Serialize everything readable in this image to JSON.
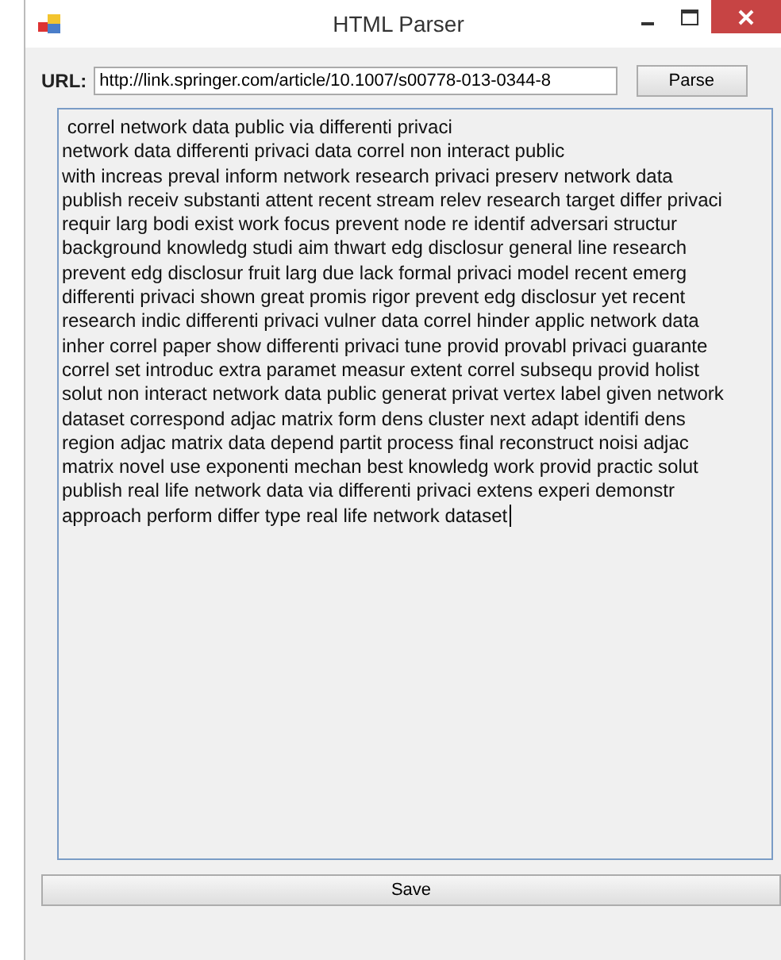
{
  "window": {
    "title": "HTML Parser"
  },
  "url_field": {
    "label": "URL:",
    "value": "http://link.springer.com/article/10.1007/s00778-013-0344-8"
  },
  "parse_button": "Parse",
  "output_lines": [
    " correl network data public via differenti privaci",
    "network data differenti privaci data correl non interact public",
    "with increas preval inform network research privaci preserv network data",
    "publish receiv substanti attent recent stream relev research target differ privaci",
    "requir larg bodi exist work focus prevent node re identif adversari structur",
    "background knowledg studi aim thwart edg disclosur general line research",
    "prevent edg disclosur fruit larg due lack formal privaci model recent emerg",
    "differenti privaci shown great promis rigor prevent edg disclosur yet recent",
    "research indic differenti privaci vulner data correl hinder applic network data",
    "inher correl paper show differenti privaci tune provid provabl privaci guarante",
    "correl set introduc extra paramet measur extent correl subsequ provid holist",
    "solut non interact network data public generat privat vertex label given network",
    "dataset correspond adjac matrix form dens cluster next adapt identifi dens",
    "region adjac matrix data depend partit process final reconstruct noisi adjac",
    "matrix novel use exponenti mechan best knowledg work provid practic solut",
    "publish real life network data via differenti privaci extens experi demonstr",
    "approach perform differ type real life network dataset"
  ],
  "save_button": "Save"
}
